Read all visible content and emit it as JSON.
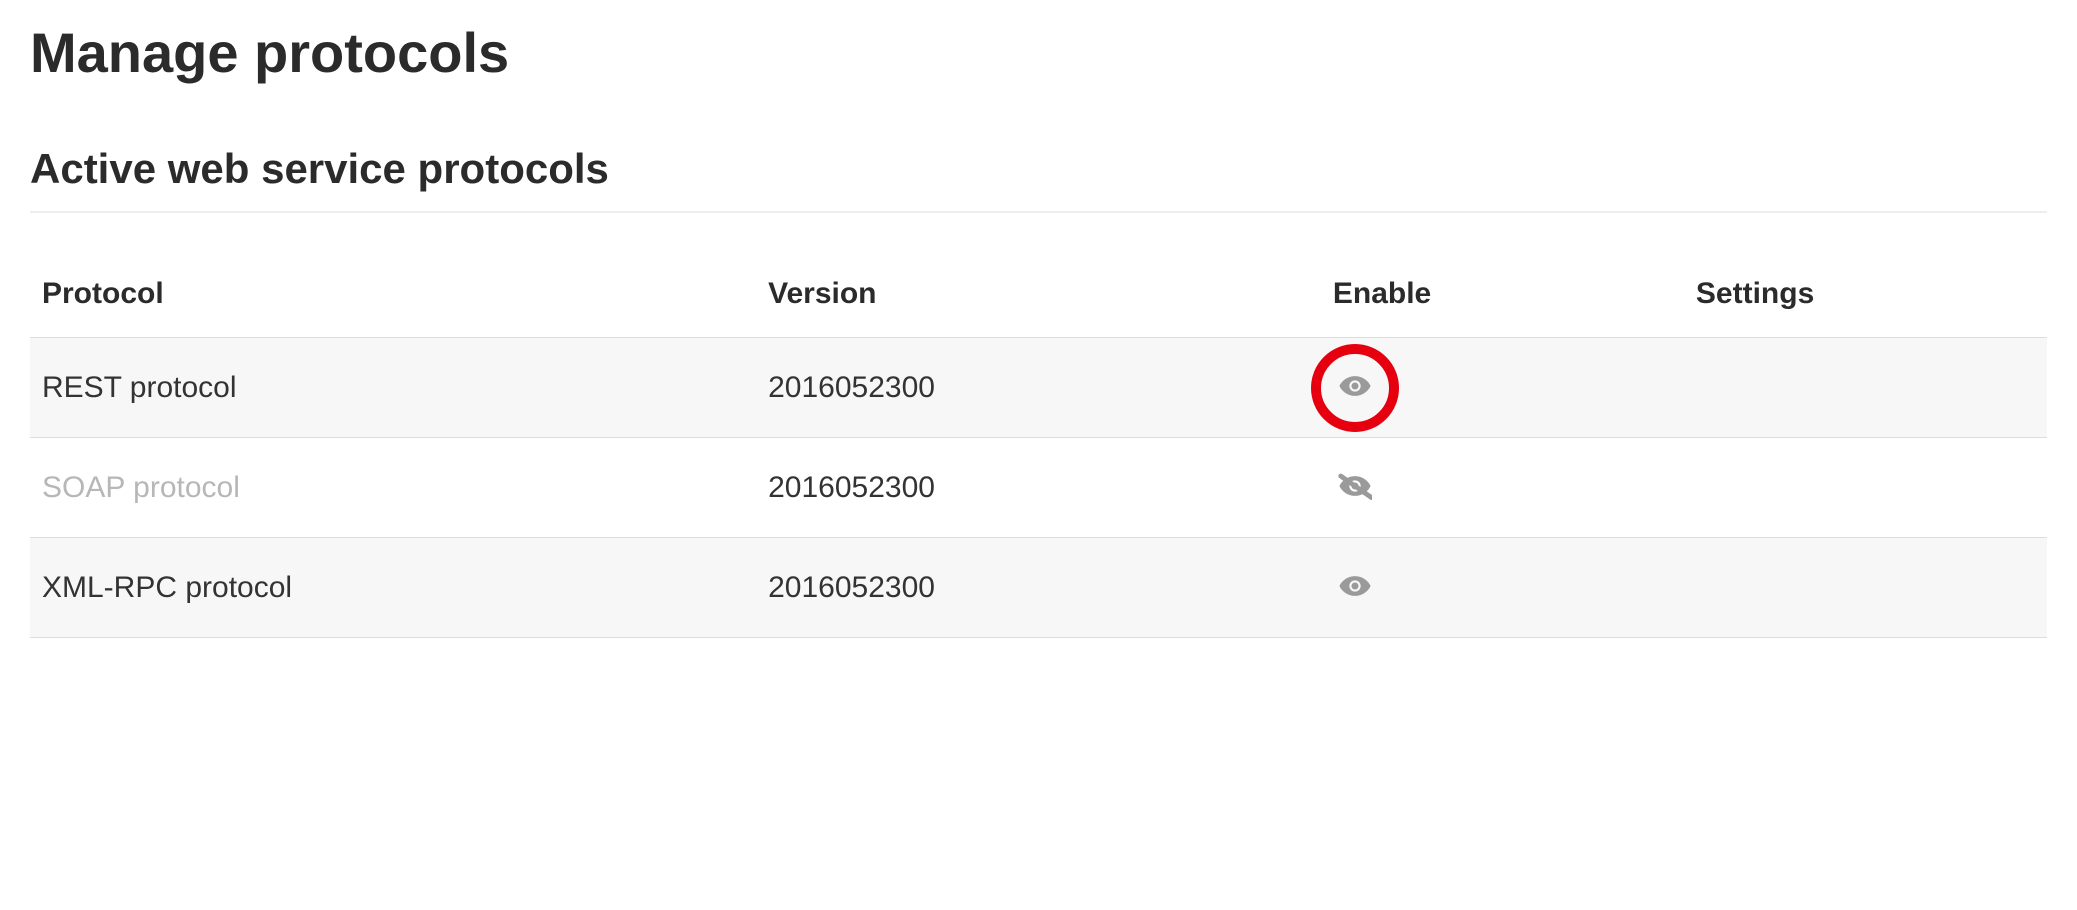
{
  "page": {
    "title": "Manage protocols",
    "section_title": "Active web service protocols"
  },
  "table": {
    "headers": {
      "protocol": "Protocol",
      "version": "Version",
      "enable": "Enable",
      "settings": "Settings"
    },
    "rows": [
      {
        "name": "REST protocol",
        "version": "2016052300",
        "enabled": true,
        "highlighted": true
      },
      {
        "name": "SOAP protocol",
        "version": "2016052300",
        "enabled": false,
        "highlighted": false
      },
      {
        "name": "XML-RPC protocol",
        "version": "2016052300",
        "enabled": true,
        "highlighted": false
      }
    ]
  }
}
